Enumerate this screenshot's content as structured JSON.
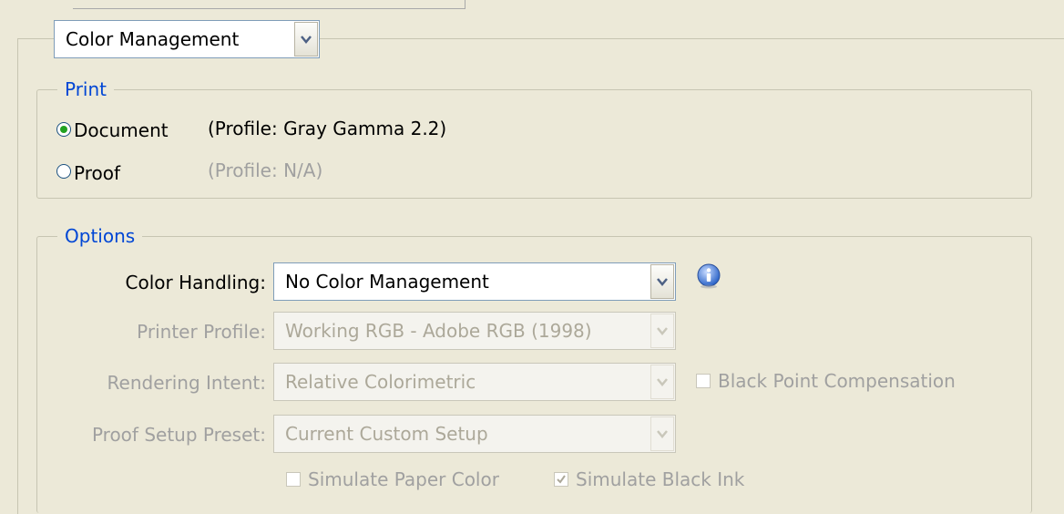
{
  "section_selector": {
    "value": "Color Management"
  },
  "print_group": {
    "legend": "Print",
    "document": {
      "label": "Document",
      "profile": "(Profile: Gray Gamma 2.2)",
      "selected": true
    },
    "proof": {
      "label": "Proof",
      "profile": "(Profile: N/A)",
      "selected": false
    }
  },
  "options_group": {
    "legend": "Options",
    "color_handling": {
      "label": "Color Handling:",
      "value": "No Color Management"
    },
    "printer_profile": {
      "label": "Printer Profile:",
      "value": "Working RGB - Adobe RGB (1998)"
    },
    "rendering_intent": {
      "label": "Rendering Intent:",
      "value": "Relative Colorimetric"
    },
    "black_point": {
      "label": "Black Point Compensation",
      "checked": false
    },
    "proof_setup_preset": {
      "label": "Proof Setup Preset:",
      "value": "Current Custom Setup"
    },
    "simulate_paper_color": {
      "label": "Simulate Paper Color",
      "checked": false
    },
    "simulate_black_ink": {
      "label": "Simulate Black Ink",
      "checked": true
    }
  },
  "colors": {
    "legend": "#0046d5",
    "disabled_text": "#a0a0a0",
    "radio_dot": "#21a121"
  },
  "icons": {
    "info": "info-icon",
    "dropdown": "chevron-down-icon"
  }
}
